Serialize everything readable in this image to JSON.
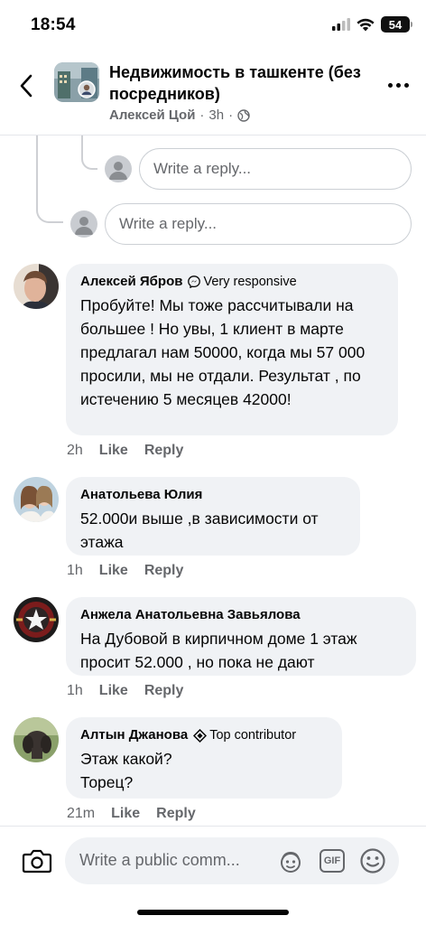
{
  "status_bar": {
    "time": "18:54",
    "battery": "54"
  },
  "header": {
    "title": "Недвижимость в ташкенте (без посредников)",
    "author": "Алексей Цой",
    "time": "3h"
  },
  "reply_inputs": [
    {
      "placeholder": "Write a reply..."
    },
    {
      "placeholder": "Write a reply..."
    }
  ],
  "comments": [
    {
      "name": "Алексей Ябров",
      "badge": "Very responsive",
      "badge_icon": "messenger-icon",
      "text": "Пробуйте! Мы тоже рассчитывали на большее ! Но увы, 1 клиент в марте предлагал нам 50000, когда мы 57 000 просили, мы не отдали. Результат , по истечению 5 месяцев 42000!",
      "time": "2h",
      "like": "Like",
      "reply": "Reply"
    },
    {
      "name": "Анатольева Юлия",
      "badge": "",
      "text": "52.000и выше ,в зависимости от этажа",
      "time": "1h",
      "like": "Like",
      "reply": "Reply"
    },
    {
      "name": "Анжела Анатольевна Завьялова",
      "badge": "",
      "text": "На Дубовой в кирпичном доме 1 этаж просит 52.000 , но пока не дают",
      "time": "1h",
      "like": "Like",
      "reply": "Reply"
    },
    {
      "name": "Алтын Джанова",
      "badge": "Top contributor",
      "badge_icon": "top-contributor-icon",
      "text": "Этаж какой?\nТорец?",
      "time": "21m",
      "like": "Like",
      "reply": "Reply"
    }
  ],
  "composer": {
    "placeholder": "Write a public comm...",
    "gif_label": "GIF"
  },
  "colors": {
    "bubble_bg": "#f0f2f5",
    "secondary_text": "#65676b",
    "divider": "#e4e6eb"
  }
}
